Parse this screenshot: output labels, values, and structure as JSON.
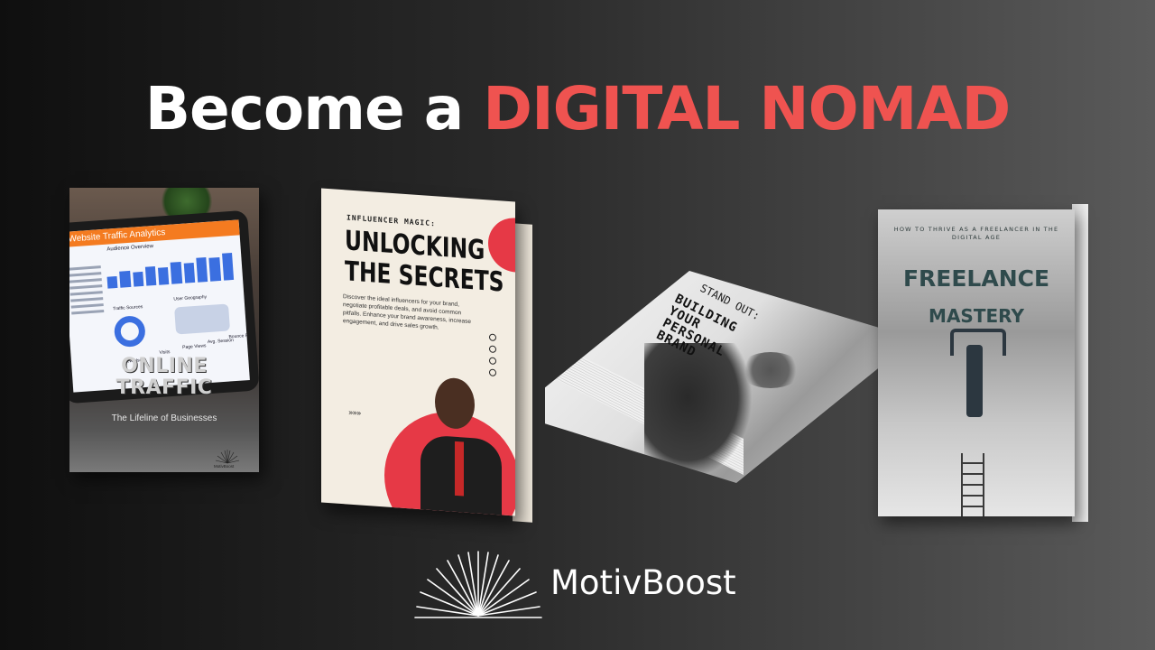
{
  "headline": {
    "lead": "Become a",
    "accent": "DIGITAL NOMAD"
  },
  "colors": {
    "accent": "#ef5350",
    "background_left": "#0f0f0f",
    "background_right": "#5a5a5a"
  },
  "books": [
    {
      "title": "ONLINE TRAFFIC",
      "subtitle": "The Lifeline of Businesses",
      "screen_title": "Website Traffic Analytics",
      "screen_heading": "Audience Overview",
      "screen_labels": [
        "User Geography",
        "Traffic Sources",
        "New Users",
        "Visits",
        "Page Views",
        "Avg. Session",
        "Bounce Rate"
      ],
      "logo_text": "MotivBoost"
    },
    {
      "kicker": "INFLUENCER MAGIC:",
      "title_line1": "UNLOCKING",
      "title_line2": "THE SECRETS",
      "description": "Discover the ideal influencers for your brand, negotiate profitable deals, and avoid common pitfalls. Enhance your brand awareness, increase engagement, and drive sales growth.",
      "chevrons": "»»»"
    },
    {
      "kicker": "STAND OUT:",
      "title_lines": [
        "BUILDING",
        "YOUR",
        "PERSONAL",
        "BRAND"
      ]
    },
    {
      "kicker": "HOW TO THRIVE AS A FREELANCER IN THE DIGITAL AGE",
      "title_line1": "FREELANCE",
      "title_line2": "MASTERY"
    }
  ],
  "brand": {
    "name": "MotivBoost",
    "logo_icon": "sunburst-icon"
  }
}
